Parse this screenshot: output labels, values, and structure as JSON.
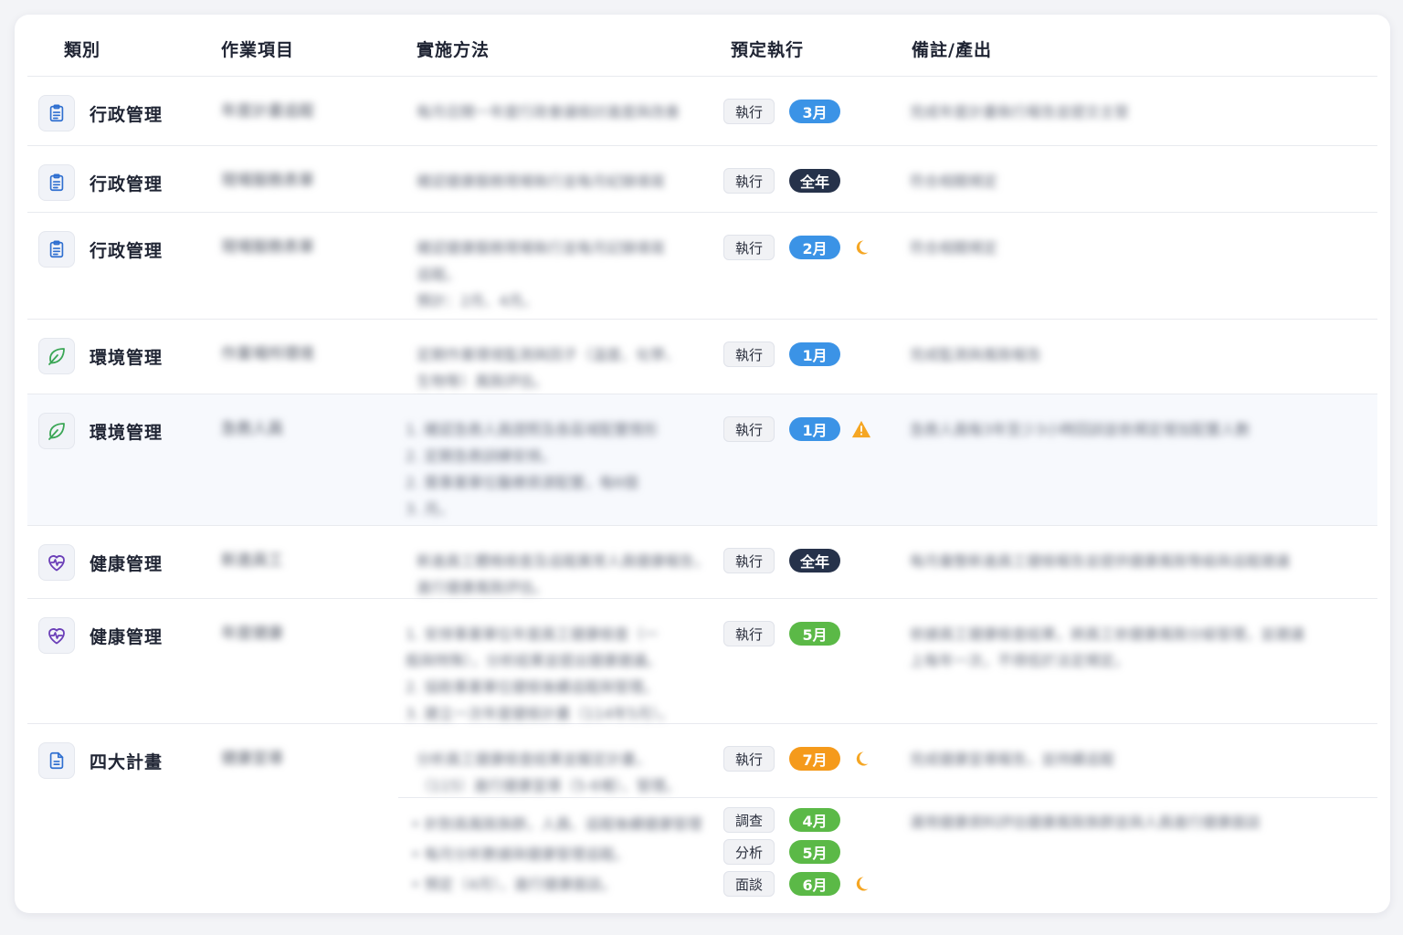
{
  "columns": {
    "category": "類別",
    "item": "作業項目",
    "method": "實施方法",
    "schedule": "預定執行",
    "note": "備註/產出"
  },
  "colors": {
    "pill_blue": "#3b93e6",
    "pill_dark": "#26324a",
    "pill_green": "#5bb947",
    "pill_orange": "#f59a1b",
    "icon_admin": "#2f6fd0",
    "icon_env": "#3aa655",
    "icon_health": "#6b3fb8",
    "moon": "#f5a623",
    "warning": "#f5a623"
  },
  "rows": [
    {
      "category": "行政管理",
      "icon": "clipboard-icon",
      "item": "年度計畫追蹤",
      "method": [
        "每月召開一年度行政會議檢討進度與改善"
      ],
      "tag": "執行",
      "month": "3月",
      "month_color": "blue",
      "flag": "",
      "note": [
        "完成年度計畫執行報告並提交主管"
      ]
    },
    {
      "category": "行政管理",
      "icon": "clipboard-icon",
      "item": "現場服務表單",
      "method": [
        "確認健康服務現場執行並每月紀錄填寫"
      ],
      "tag": "執行",
      "month": "全年",
      "month_color": "dark",
      "flag": "",
      "note": [
        "符合相關規定"
      ]
    },
    {
      "category": "行政管理",
      "icon": "clipboard-icon",
      "item": "現場服務表單",
      "method": [
        "確認健康服務現場執行並每月記錄填寫",
        "追蹤。",
        "預計：2月、4月。"
      ],
      "tag": "執行",
      "month": "2月",
      "month_color": "blue",
      "flag": "moon-icon",
      "note": [
        "符合相關規定"
      ]
    },
    {
      "category": "環境管理",
      "icon": "leaf-icon",
      "item": "作業場所環境",
      "method": [
        "定期作業環境監測與因子（溫度、化學、",
        "生物等）風險評估。"
      ],
      "tag": "執行",
      "month": "1月",
      "month_color": "blue",
      "flag": "",
      "note": [
        "完成監測與風險報告"
      ]
    },
    {
      "category": "環境管理",
      "icon": "leaf-icon",
      "item": "急救人員",
      "method": [
        "1. 確認急救人員證照及各區域配置情形",
        "2. 定期急救訓練安排。",
        "2. 需事業單位醫療資源配置，每6個",
        "3. 月。"
      ],
      "tag": "執行",
      "month": "1月",
      "month_color": "blue",
      "flag": "warning-icon",
      "note": [
        "急救人員每3年至少3小時回訓並依規定增加配置人數"
      ]
    },
    {
      "category": "健康管理",
      "icon": "heartbeat-icon",
      "item": "新進員工",
      "method": [
        "新進員工體格檢查及追蹤異常人員健康報告，",
        "進行健康風險評估。"
      ],
      "tag": "執行",
      "month": "全年",
      "month_color": "dark",
      "flag": "",
      "note": [
        "每月彙整新進員工健檢報告並提供健康風險等級與追蹤建議"
      ]
    },
    {
      "category": "健康管理",
      "icon": "heartbeat-icon",
      "item": "年度健康",
      "method": [
        "1. 安排事業單位年度員工健康檢查（一",
        "般與特殊），分析結果並提出健康建議。",
        "2. 協助事業單位健檢後續追蹤與管理。",
        "3. 建立一次年度健檢計畫（114年5月）。"
      ],
      "tag": "執行",
      "month": "5月",
      "month_color": "green",
      "flag": "",
      "note": [
        "依據員工健康檢查結果，將員工依健康風險分級管理，並建議",
        "上每年一次，不得低於法定規定。"
      ]
    },
    {
      "category": "四大計畫",
      "icon": "document-icon",
      "item": "健康宣導",
      "method": [
        "分析員工健康檢查結果並擬定計畫，",
        "（115）進行健康宣導（5-6場）、管理。"
      ],
      "tag": "執行",
      "month": "7月",
      "month_color": "orange",
      "flag": "moon-icon",
      "note": [
        "完成健康宣導報告，並持續追蹤"
      ],
      "sub": {
        "method": [
          "• 針對高風險族群，人員、追蹤後續健康管理",
          "• 每月分析數據與健康管理追蹤。",
          "• 預定（4月），進行健康面談。"
        ],
        "note": [
          "運用健康資料評估健康風險族群並與人員進行健康面談"
        ],
        "entries": [
          {
            "tag": "調查",
            "month": "4月",
            "month_color": "green",
            "flag": ""
          },
          {
            "tag": "分析",
            "month": "5月",
            "month_color": "green",
            "flag": ""
          },
          {
            "tag": "面談",
            "month": "6月",
            "month_color": "green",
            "flag": "moon-icon"
          }
        ]
      }
    }
  ]
}
